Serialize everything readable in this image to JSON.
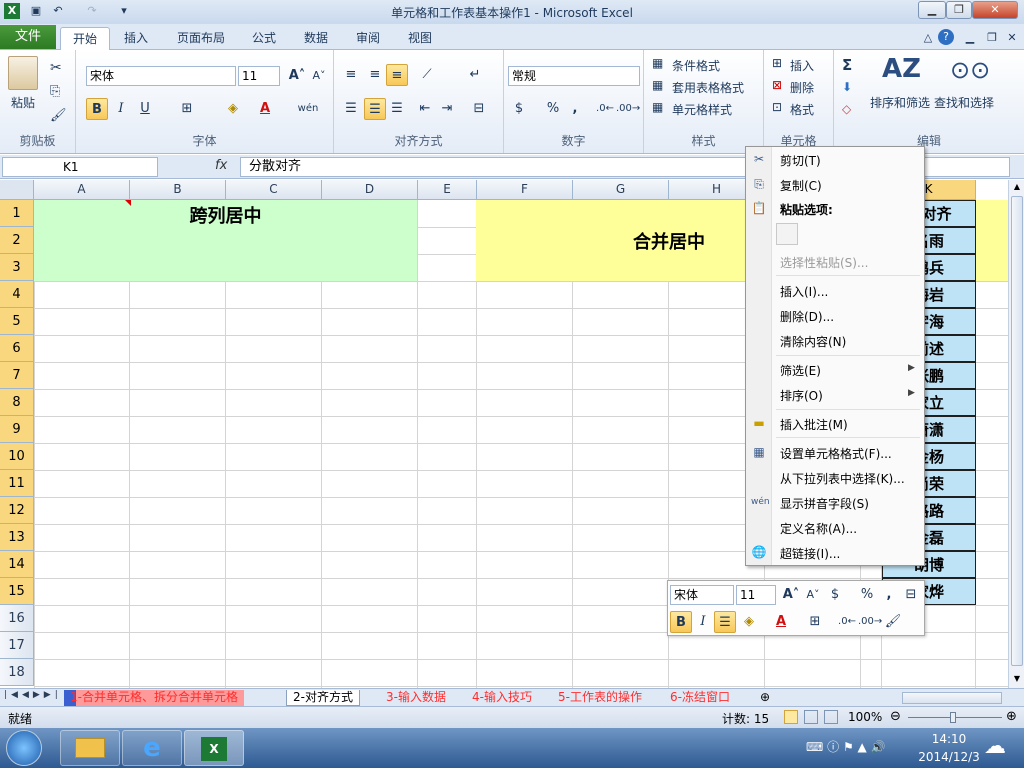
{
  "window": {
    "title": "单元格和工作表基本操作1 - Microsoft Excel"
  },
  "ribbon": {
    "tabs": [
      "文件",
      "开始",
      "插入",
      "页面布局",
      "公式",
      "数据",
      "审阅",
      "视图"
    ],
    "clipboard": {
      "paste": "粘贴",
      "group": "剪贴板"
    },
    "font": {
      "name": "宋体",
      "size": "11",
      "group": "字体",
      "bold": "B",
      "italic": "I",
      "underline": "U",
      "phonetic": "wén"
    },
    "alignment": {
      "group": "对齐方式"
    },
    "number": {
      "format": "常规",
      "group": "数字",
      "percent": "%",
      "comma": ","
    },
    "styles": {
      "conditional": "条件格式",
      "table": "套用表格格式",
      "cell": "单元格样式",
      "group": "样式"
    },
    "cells": {
      "insert": "插入",
      "delete": "删除",
      "format": "格式",
      "group": "单元格"
    },
    "editing": {
      "sort": "排序和筛选",
      "find": "查找和选择",
      "group": "编辑",
      "sum": "Σ"
    }
  },
  "formula_bar": {
    "name_box": "K1",
    "fx": "fx",
    "value": "分散对齐"
  },
  "sheet": {
    "columns": [
      "A",
      "B",
      "C",
      "D",
      "E",
      "F",
      "G",
      "H",
      "I",
      "J",
      "K"
    ],
    "rows": [
      "1",
      "2",
      "3",
      "4",
      "5",
      "6",
      "7",
      "8",
      "9",
      "10",
      "11",
      "12",
      "13",
      "14",
      "15",
      "16",
      "17",
      "18"
    ],
    "merge_center_across": "跨列居中",
    "merge_and_center": "合并居中",
    "k_column": [
      "散对齐",
      "名雨",
      "鹏兵",
      "海岩",
      "宇海",
      "前述",
      "张鹏",
      "家立",
      "萧潇",
      "金杨",
      "尚荣",
      "路路",
      "金磊",
      "胡博",
      "家烨"
    ],
    "colors": {
      "green": "#ccffcc",
      "yellow": "#ffff99",
      "blue": "#bfe3f6"
    }
  },
  "context_menu": {
    "cut": "剪切(T)",
    "copy": "复制(C)",
    "paste_options": "粘贴选项:",
    "paste_special": "选择性粘贴(S)...",
    "insert": "插入(I)...",
    "delete": "删除(D)...",
    "clear": "清除内容(N)",
    "filter": "筛选(E)",
    "sort": "排序(O)",
    "insert_comment": "插入批注(M)",
    "format_cells": "设置单元格格式(F)...",
    "pick_list": "从下拉列表中选择(K)...",
    "phonetic": "显示拼音字段(S)",
    "define_name": "定义名称(A)...",
    "hyperlink": "超链接(I)..."
  },
  "mini_toolbar": {
    "font": "宋体",
    "size": "11",
    "bold": "B",
    "italic": "I",
    "percent": "%",
    "comma": ","
  },
  "sheet_tabs": [
    "1-合并单元格、拆分合并单元格",
    "2-对齐方式",
    "3-输入数据",
    "4-输入技巧",
    "5-工作表的操作",
    "6-冻结窗口"
  ],
  "status": {
    "ready": "就绪",
    "count": "计数: 15",
    "zoom": "100%"
  },
  "taskbar": {
    "time": "14:10",
    "date": "2014/12/3"
  }
}
